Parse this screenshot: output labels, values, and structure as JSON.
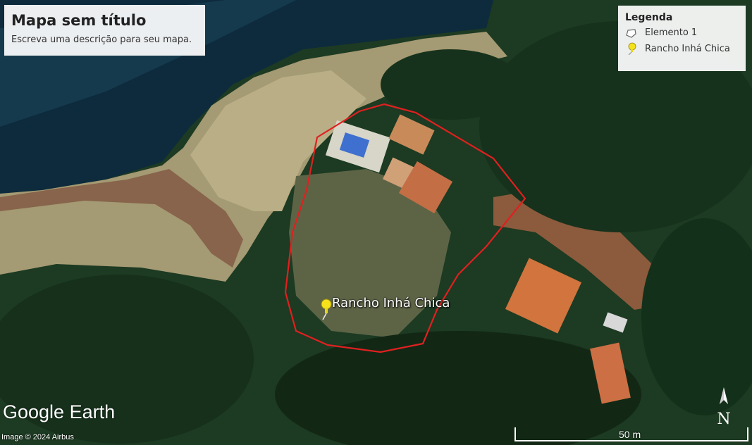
{
  "title": "Mapa sem título",
  "description": "Escreva uma descrição para seu mapa.",
  "legend": {
    "heading": "Legenda",
    "items": [
      {
        "label": "Elemento 1",
        "icon": "polygon-icon"
      },
      {
        "label": "Rancho Inhá Chica",
        "icon": "yellow-pushpin-icon"
      }
    ]
  },
  "placemark": {
    "label": "Rancho Inhá Chica",
    "icon": "yellow-pushpin-icon"
  },
  "branding": {
    "logo_text": "Google Earth",
    "attribution": "Image © 2024 Airbus"
  },
  "scale": {
    "label": "50 m"
  },
  "north": {
    "label": "N"
  },
  "colors": {
    "polygon_outline": "#e02020",
    "pin": "#f5e21b",
    "water": "#0c2a3a",
    "forest": "#1d3a22"
  }
}
